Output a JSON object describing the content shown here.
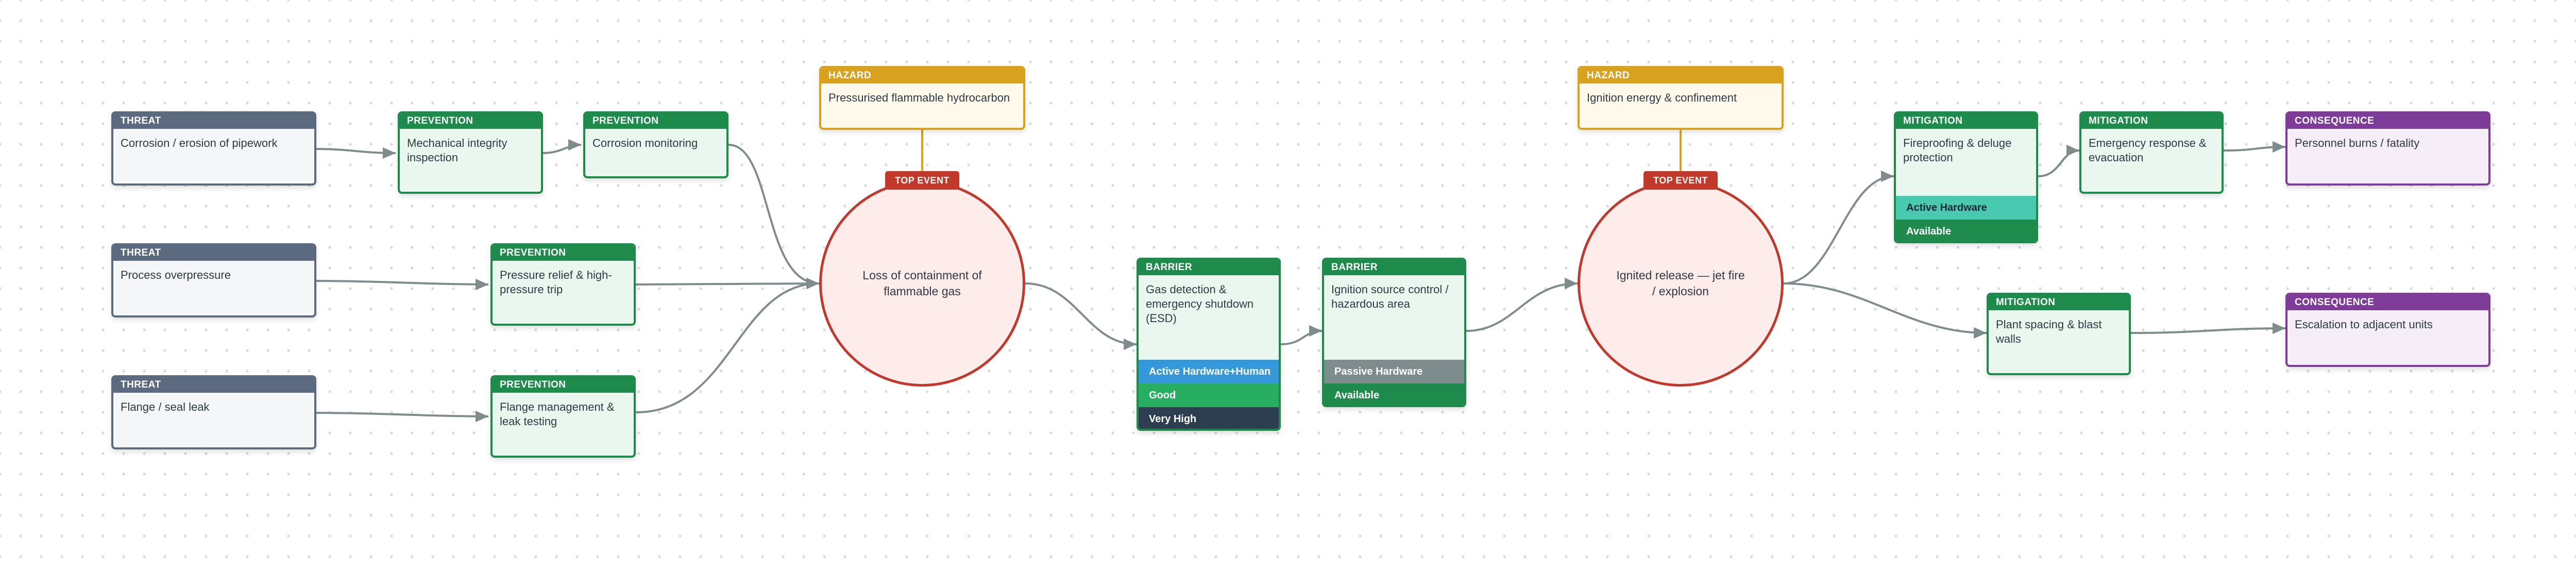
{
  "hazards": [
    {
      "label": "HAZARD",
      "text": "Pressurised flammable hydrocarbon"
    },
    {
      "label": "HAZARD",
      "text": "Ignition energy & confinement"
    }
  ],
  "top_events": [
    {
      "badge": "TOP EVENT",
      "text": "Loss of containment of flammable gas"
    },
    {
      "badge": "TOP EVENT",
      "text": "Ignited release — jet fire / explosion"
    }
  ],
  "threats": [
    {
      "label": "THREAT",
      "text": "Corrosion / erosion of pipework"
    },
    {
      "label": "THREAT",
      "text": "Process overpressure"
    },
    {
      "label": "THREAT",
      "text": "Flange / seal leak"
    }
  ],
  "preventions": [
    {
      "label": "PREVENTION",
      "text": "Mechanical integrity inspection"
    },
    {
      "label": "PREVENTION",
      "text": "Corrosion monitoring"
    },
    {
      "label": "PREVENTION",
      "text": "Pressure relief & high-pressure trip"
    },
    {
      "label": "PREVENTION",
      "text": "Flange management & leak testing"
    }
  ],
  "barriers": [
    {
      "label": "BARRIER",
      "text": "Gas detection & emergency shutdown (ESD)",
      "type": "Active Hardware+Human",
      "type_color": "#3498db",
      "effectiveness": "Good",
      "effectiveness_color": "#27ae60",
      "criticality": "Very High",
      "criticality_color": "#2c3e50"
    },
    {
      "label": "BARRIER",
      "text": "Ignition source control / hazardous area",
      "type": "Passive Hardware",
      "type_color": "#7f8c8d",
      "status": "Available",
      "status_color": "#1e8a4c"
    }
  ],
  "mitigations": [
    {
      "label": "MITIGATION",
      "text": "Fireproofing & deluge protection",
      "type": "Active Hardware",
      "type_color": "#48c9b0",
      "status": "Available",
      "status_color": "#1e8a4c"
    },
    {
      "label": "MITIGATION",
      "text": "Emergency response & evacuation"
    },
    {
      "label": "MITIGATION",
      "text": "Plant spacing & blast walls"
    }
  ],
  "consequences": [
    {
      "label": "CONSEQUENCE",
      "text": "Personnel burns / fatality"
    },
    {
      "label": "CONSEQUENCE",
      "text": "Escalation to adjacent units"
    }
  ],
  "colors": {
    "threat": "#5b6a7e",
    "prevention": "#1e8a4c",
    "hazard": "#d9a21e",
    "top_event": "#c0392b",
    "consequence": "#7d3c98",
    "connector": "#7f8c8d"
  }
}
